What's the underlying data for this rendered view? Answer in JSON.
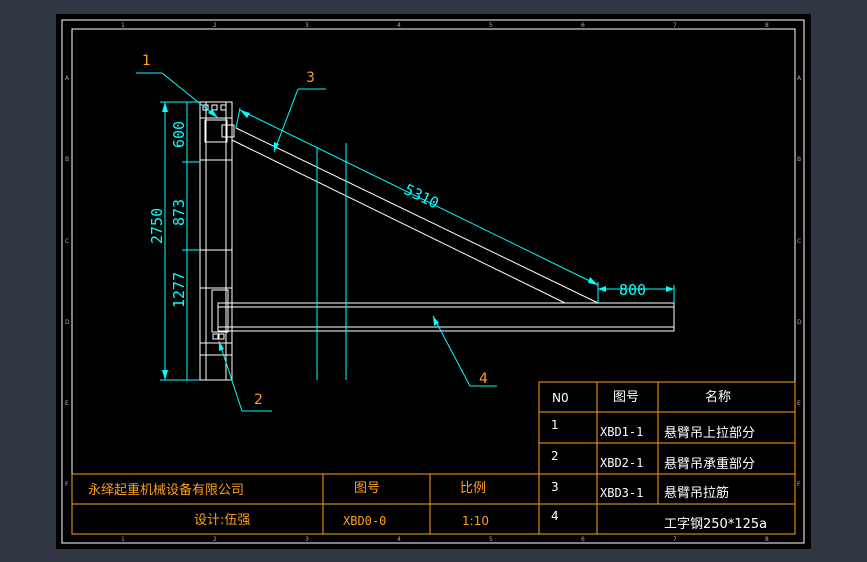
{
  "colors": {
    "background": "#303742",
    "sheet": "#000000",
    "frame": "#ffffff",
    "geometry": "#ffffff",
    "dimension": "#00ffff",
    "callout": "#00ffff",
    "callout_text": "#ff9f1a",
    "title_block": "#ff9f1a",
    "table_text": "#ffffff"
  },
  "frame": {
    "row_zones": [
      "A",
      "B",
      "C",
      "D",
      "E",
      "F"
    ],
    "col_zones": [
      "1",
      "2",
      "3",
      "4",
      "5",
      "6",
      "7",
      "8"
    ]
  },
  "dimensions": {
    "total_height": "2750",
    "upper_segment": "600",
    "middle_segment": "873",
    "lower_segment": "1277",
    "diagonal_length": "5310",
    "beam_extension": "800"
  },
  "callouts": [
    "1",
    "2",
    "3",
    "4"
  ],
  "parts_table": {
    "headers": {
      "no": "N0",
      "drawing_no": "图号",
      "name": "名称"
    },
    "rows": [
      {
        "no": "1",
        "drawing_no": "XBD1-1",
        "name": "悬臂吊上拉部分"
      },
      {
        "no": "2",
        "drawing_no": "XBD2-1",
        "name": "悬臂吊承重部分"
      },
      {
        "no": "3",
        "drawing_no": "XBD3-1",
        "name": "悬臂吊拉筋"
      },
      {
        "no": "4",
        "drawing_no": "",
        "name": "工字钢250*125a"
      }
    ]
  },
  "title_block": {
    "company": "永绎起重机械设备有限公司",
    "designer": "设计:伍强",
    "drawing_no_label": "图号",
    "drawing_no": "XBD0-0",
    "scale_label": "比例",
    "scale": "1:10"
  }
}
